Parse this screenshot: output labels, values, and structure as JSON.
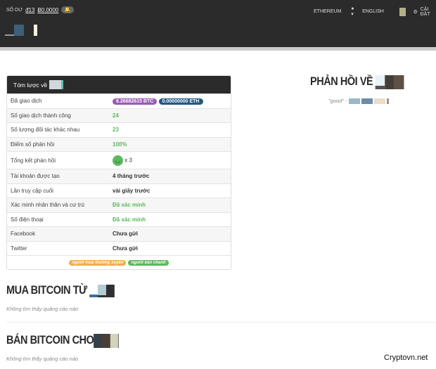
{
  "topbar": {
    "balance_label": "SỐ DƯ",
    "balance_fiat": "đ13",
    "balance_btc": "Ƀ0.0000",
    "ethereum": "ETHEREUM",
    "language": "ENGLISH",
    "settings": "CÀI ĐẶT"
  },
  "summary": {
    "title": "Tóm lược về",
    "rows": [
      {
        "label": "Đã giao dịch",
        "btc": "8.26682615 BTC",
        "eth": "0.00000000 ETH"
      },
      {
        "label": "Số giao dịch thành công",
        "value": "24"
      },
      {
        "label": "Số lượng đối tác khác nhau",
        "value": "23"
      },
      {
        "label": "Điểm số phản hồi",
        "value": "100%"
      },
      {
        "label": "Tổng kết phản hồi",
        "value": "x 3"
      },
      {
        "label": "Tài khoản được tạo",
        "value": "4 tháng trước"
      },
      {
        "label": "Lần truy cập cuối",
        "value": "vài giây trước"
      },
      {
        "label": "Xác minh nhân thân và cư trú",
        "value": "Đã xác minh"
      },
      {
        "label": "Số điện thoại",
        "value": "Đã xác minh"
      },
      {
        "label": "Facebook",
        "value": "Chưa gửi"
      },
      {
        "label": "Twitter",
        "value": "Chưa gửi"
      }
    ],
    "tags": [
      "người mua thường xuyên",
      "người bán nhanh"
    ]
  },
  "feedback": {
    "title": "PHẢN HỒI VỀ",
    "quote": "\"good\" -"
  },
  "buy": {
    "title": "MUA BITCOIN TỪ",
    "empty": "Không tìm thấy quảng cáo nào"
  },
  "sell": {
    "title": "BÁN BITCOIN CHO",
    "empty": "Không tìm thấy quảng cáo nào"
  },
  "watermark": "Cryptovn.net"
}
